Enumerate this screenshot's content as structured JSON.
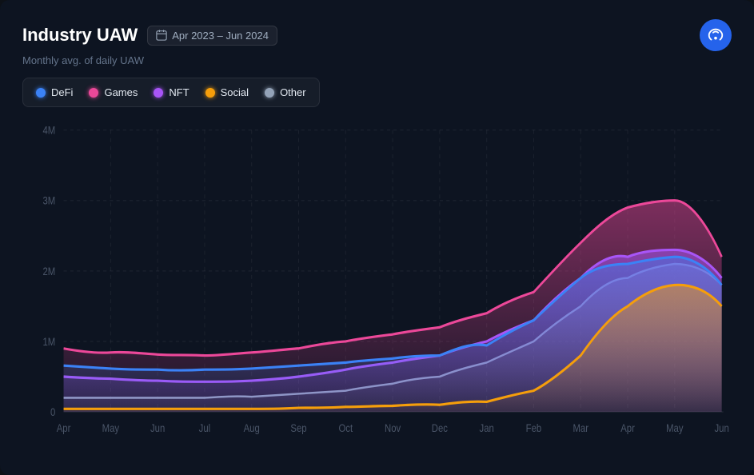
{
  "header": {
    "title": "Industry UAW",
    "date_range": "Apr 2023 – Jun 2024",
    "subtitle": "Monthly avg. of daily UAW"
  },
  "legend": {
    "items": [
      {
        "label": "DeFi",
        "color": "#3b82f6"
      },
      {
        "label": "Games",
        "color": "#ec4899"
      },
      {
        "label": "NFT",
        "color": "#a855f7"
      },
      {
        "label": "Social",
        "color": "#f59e0b"
      },
      {
        "label": "Other",
        "color": "#94a3b8"
      }
    ]
  },
  "yAxis": {
    "labels": [
      "4M",
      "3M",
      "2M",
      "1M",
      "0"
    ]
  },
  "xAxis": {
    "labels": [
      "Apr",
      "May",
      "Jun",
      "Jul",
      "Aug",
      "Sep",
      "Oct",
      "Nov",
      "Dec",
      "Jan",
      "Feb",
      "Mar",
      "Apr",
      "May",
      "Jun"
    ]
  },
  "logo": {
    "icon": "wifi-icon"
  }
}
